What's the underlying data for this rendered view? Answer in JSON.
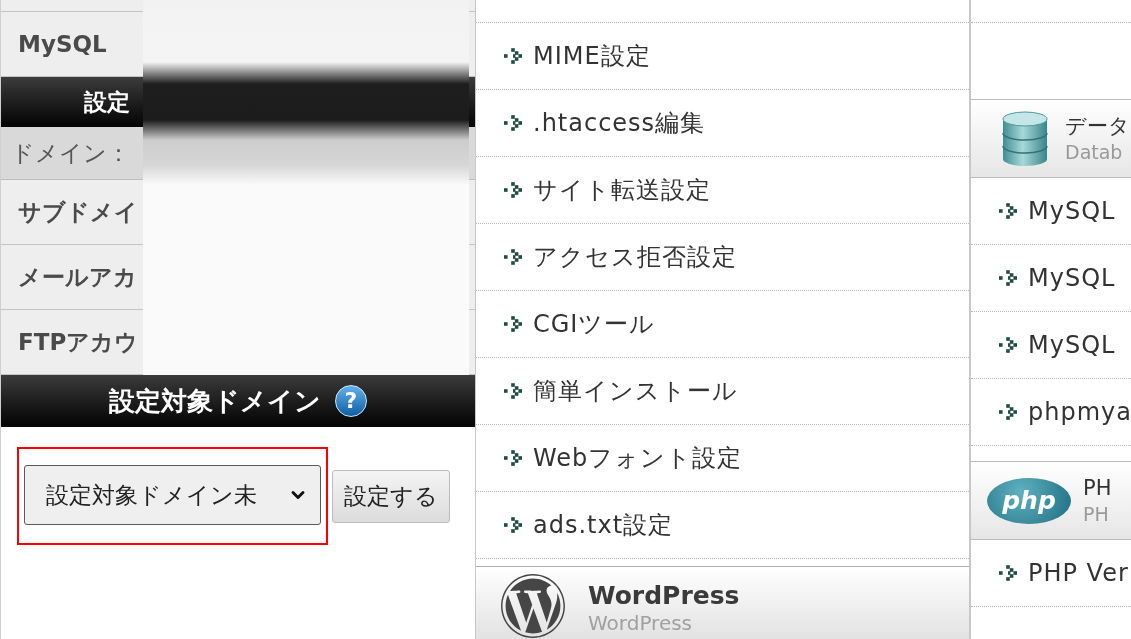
{
  "account_panel": {
    "rows": [
      {
        "kind": "item",
        "label": "MySQL"
      },
      {
        "kind": "header",
        "label": "設定"
      },
      {
        "kind": "domain",
        "label": "ドメイン："
      },
      {
        "kind": "item",
        "label": "サブドメイ"
      },
      {
        "kind": "item",
        "label": "メールアカ"
      },
      {
        "kind": "item",
        "label": "FTPアカウ"
      }
    ]
  },
  "domain_panel": {
    "title": "設定対象ドメイン",
    "help": "?",
    "select": {
      "value": "設定対象ドメイン未",
      "highlighted": true
    },
    "button": "設定する"
  },
  "menu_column": {
    "items": [
      "MIME設定",
      ".htaccess編集",
      "サイト転送設定",
      "アクセス拒否設定",
      "CGIツール",
      "簡単インストール",
      "Webフォント設定",
      "ads.txt設定"
    ],
    "section": {
      "title": "WordPress",
      "subtitle": "WordPress"
    }
  },
  "side_column": {
    "sections": [
      {
        "kind": "database",
        "title": "データ",
        "subtitle": "Datab",
        "items": [
          "MySQL",
          "MySQL",
          "MySQL",
          "phpmya"
        ]
      },
      {
        "kind": "php",
        "title": "PH",
        "subtitle": "PH",
        "logo": "php",
        "items": [
          "PHP Ver"
        ]
      }
    ]
  }
}
